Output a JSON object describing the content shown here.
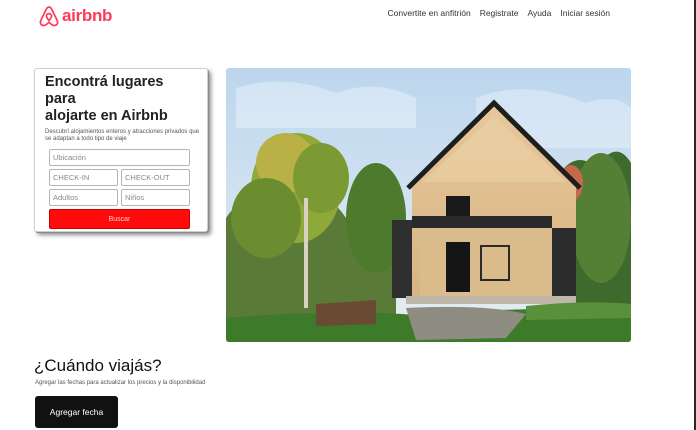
{
  "brand": {
    "name": "airbnb",
    "color": "#ff385c",
    "icon": "airbnb-belo-icon"
  },
  "nav": [
    {
      "label": "Convertite en anfitrión"
    },
    {
      "label": "Registrate"
    },
    {
      "label": "Ayuda"
    },
    {
      "label": "Iniciar sesión"
    }
  ],
  "search": {
    "title_line1": "Encontrá lugares para",
    "title_line2": "alojarte en Airbnb",
    "description": "Descubrí alojamientos enteros y atracciones privados que se adaptan a todo tipo de viaje",
    "location_placeholder": "Ubicación",
    "checkin_placeholder": "CHECK-IN",
    "checkout_placeholder": "CHECK-OUT",
    "adults_placeholder": "Adultos",
    "children_placeholder": "Niños",
    "button_label": "Buscar",
    "button_color": "#ff0b0b"
  },
  "when": {
    "title": "¿Cuándo viajás?",
    "subtitle": "Agregar las fechas para actualizar los precios y la disponibilidad",
    "button_label": "Agregar fecha"
  }
}
